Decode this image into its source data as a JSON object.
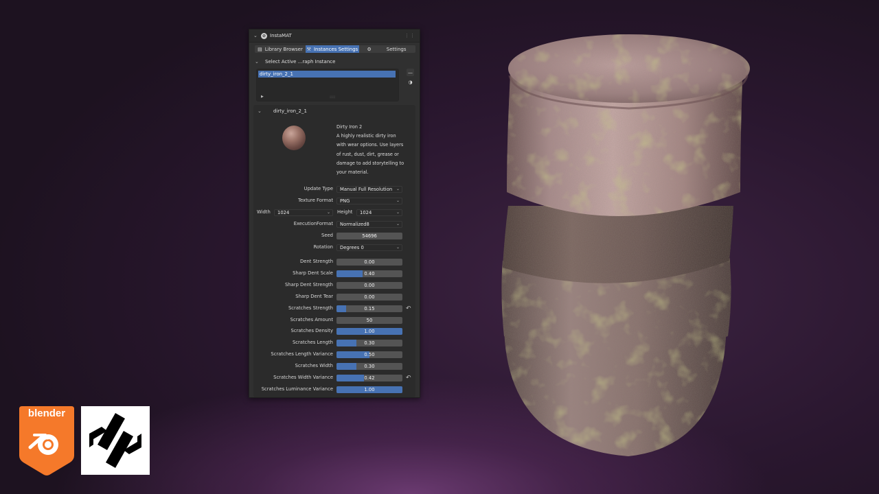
{
  "panel": {
    "title": "InstaMAT",
    "tabs": [
      {
        "label": "Library Browser",
        "icon": "folder-icon",
        "active": false
      },
      {
        "label": "Instances Settings",
        "icon": "tools-icon",
        "active": true
      },
      {
        "label": "Settings",
        "icon": "wrench-icon",
        "active": false
      }
    ],
    "select_header": "Select Active ...raph Instance",
    "list": {
      "selected_item": "dirty_iron_2_1"
    },
    "section_title": "dirty_iron_2_1",
    "material": {
      "name": "Dirty Iron 2",
      "description_lines": [
        "A highly realistic dirty iron",
        "with wear options. Use layers",
        "of rust, dust, dirt, grease or",
        "damage to add storytelling to",
        "your material."
      ]
    },
    "settings": {
      "update_type": {
        "label": "Update Type",
        "value": "Manual Full Resolution"
      },
      "texture_format": {
        "label": "Texture Format",
        "value": "PNG"
      },
      "width": {
        "label": "Width",
        "value": "1024"
      },
      "height": {
        "label": "Height",
        "value": "1024"
      },
      "execution_format": {
        "label": "ExecutionFormat",
        "value": "Normalized8"
      },
      "seed": {
        "label": "Seed",
        "value": "54696"
      },
      "rotation": {
        "label": "Rotation",
        "value": "Degrees 0"
      }
    },
    "parameters": [
      {
        "label": "Dent Strength",
        "value": "0.00",
        "fraction": 0.0,
        "reset": false
      },
      {
        "label": "Sharp Dent Scale",
        "value": "0.40",
        "fraction": 0.4,
        "reset": false
      },
      {
        "label": "Sharp Dent Strength",
        "value": "0.00",
        "fraction": 0.0,
        "reset": false
      },
      {
        "label": "Sharp Dent Tear",
        "value": "0.00",
        "fraction": 0.0,
        "reset": false
      },
      {
        "label": "Scratches Strength",
        "value": "0.15",
        "fraction": 0.15,
        "reset": true
      },
      {
        "label": "Scratches Amount",
        "value": "50",
        "fraction": 0.0,
        "reset": false
      },
      {
        "label": "Scratches Density",
        "value": "1.00",
        "fraction": 1.0,
        "reset": false
      },
      {
        "label": "Scratches Length",
        "value": "0.30",
        "fraction": 0.3,
        "reset": false
      },
      {
        "label": "Scratches Length Variance",
        "value": "0.50",
        "fraction": 0.5,
        "reset": false
      },
      {
        "label": "Scratches Width",
        "value": "0.30",
        "fraction": 0.3,
        "reset": false
      },
      {
        "label": "Scratches Width Variance",
        "value": "0.42",
        "fraction": 0.42,
        "reset": true
      },
      {
        "label": "Scratches Luminance Variance",
        "value": "1.00",
        "fraction": 1.0,
        "reset": false
      }
    ]
  },
  "logos": {
    "blender_text": "blender",
    "blender_color": "#f5792a",
    "instamat_icon": "instamat-logo-icon"
  },
  "colors": {
    "accent": "#4772b3",
    "panel_bg": "#303030"
  }
}
